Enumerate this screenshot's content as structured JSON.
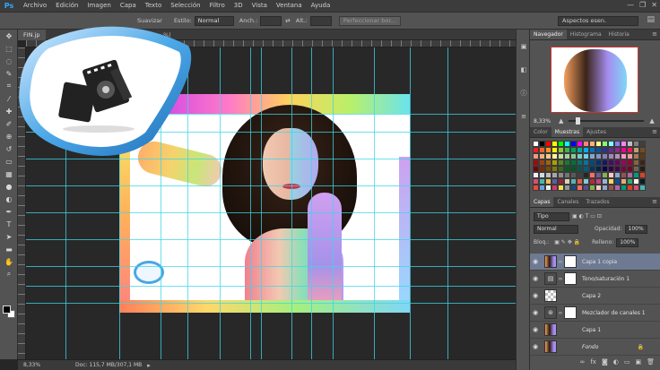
{
  "app": {
    "logo": "Ps"
  },
  "menu": [
    "Archivo",
    "Edición",
    "Imagen",
    "Capa",
    "Texto",
    "Selección",
    "Filtro",
    "3D",
    "Vista",
    "Ventana",
    "Ayuda"
  ],
  "window_controls": {
    "minimize": "—",
    "restore": "❐",
    "close": "✕"
  },
  "options": {
    "suavizar": "Suavizar",
    "estilo_label": "Estilo:",
    "estilo_value": "Normal",
    "anch_label": "Anch.:",
    "alt_label": "Alt.:",
    "perfeccionar": "Perfeccionar bor...",
    "workspace": "Aspectos esen."
  },
  "document": {
    "tab": "FIN.jp",
    "tab2": "%)",
    "status_zoom": "8,33%",
    "status_doc": "Doc: 115,7 MB/307,1 MB"
  },
  "navigator": {
    "tabs": [
      "Navegador",
      "Histograma",
      "Historia"
    ],
    "zoom": "8,33%"
  },
  "swatches_panel": {
    "tabs": [
      "Color",
      "Muestras",
      "Ajustes"
    ],
    "colors": [
      "#ffffff",
      "#000000",
      "#ff0000",
      "#ffff00",
      "#00ff00",
      "#00ffff",
      "#0000ff",
      "#ff00ff",
      "#ff8080",
      "#ffb080",
      "#ffff80",
      "#80ff80",
      "#80ffff",
      "#8080ff",
      "#ff80ff",
      "#c0c0c0",
      "#808080",
      "#404040",
      "#ee1d24",
      "#f26522",
      "#f7941d",
      "#fff200",
      "#8dc63f",
      "#39b54a",
      "#00a651",
      "#00a99d",
      "#00aeef",
      "#0072bc",
      "#0054a6",
      "#2e3192",
      "#662d91",
      "#92278f",
      "#ec008c",
      "#ed145b",
      "#c69c6d",
      "#754c24",
      "#f7977a",
      "#f9ad81",
      "#fdc68a",
      "#fff79a",
      "#c4df9b",
      "#a3d39c",
      "#82ca9c",
      "#7accc8",
      "#6dcff6",
      "#7da7d9",
      "#8393ca",
      "#8781bd",
      "#a186be",
      "#bd8cbf",
      "#f49ac2",
      "#f6989d",
      "#a67c52",
      "#603913",
      "#9e0b0f",
      "#a0410d",
      "#a3620a",
      "#aba000",
      "#598527",
      "#197b30",
      "#007236",
      "#00746b",
      "#0076a3",
      "#004a80",
      "#003471",
      "#1b1464",
      "#440e62",
      "#630460",
      "#9e005d",
      "#9e0039",
      "#8c6239",
      "#3c2415",
      "#790000",
      "#7b2e00",
      "#7d4900",
      "#827b00",
      "#406618",
      "#005e20",
      "#005826",
      "#005952",
      "#005b7f",
      "#003663",
      "#002157",
      "#0d004c",
      "#32004b",
      "#4b0049",
      "#7b0046",
      "#7a0026",
      "#736357",
      "#2a1a10",
      "#f2f2f2",
      "#d9d9d9",
      "#bfbfbf",
      "#a6a6a6",
      "#8c8c8c",
      "#737373",
      "#595959",
      "#404040",
      "#262626",
      "#ff6f61",
      "#6b5b95",
      "#88b04b",
      "#f7cac9",
      "#92a8d1",
      "#955251",
      "#b565a7",
      "#009b77",
      "#dd4124",
      "#d65076",
      "#45b8ac",
      "#efc050",
      "#5b5ea6",
      "#9b2335",
      "#dfcfbe",
      "#55b4b0",
      "#e15d44",
      "#7fcdcd",
      "#bc243c",
      "#c3447a",
      "#98b4d4",
      "#ffd662",
      "#00539c",
      "#eea47f",
      "#2bae66",
      "#fcf6f5",
      "#101820",
      "#e94b3c",
      "#6f9fd8",
      "#f0eee9",
      "#d2386c",
      "#f5df4d",
      "#939597",
      "#0f4c81",
      "#ff6f61",
      "#5f4b8b",
      "#88b04b",
      "#f7cac9",
      "#92a8d1",
      "#955251",
      "#b565a7",
      "#009b77",
      "#dd4124",
      "#d65076",
      "#45b8ac"
    ]
  },
  "layers_panel": {
    "tabs": [
      "Capas",
      "Canales",
      "Trazados"
    ],
    "kind": "Tipo",
    "blend": "Normal",
    "opacity_label": "Opacidad:",
    "opacity": "100%",
    "lock_label": "Bloq.:",
    "fill_label": "Relleno:",
    "fill": "100%",
    "layers": [
      {
        "name": "Capa 1 copia",
        "thumb": "photo",
        "mask": true,
        "selected": true,
        "italic": false,
        "locked": false
      },
      {
        "name": "Tono/saturación 1",
        "thumb": "adj",
        "mask": true,
        "selected": false,
        "italic": false,
        "locked": false
      },
      {
        "name": "Capa 2",
        "thumb": "checker",
        "mask": false,
        "selected": false,
        "italic": false,
        "locked": false
      },
      {
        "name": "Mezclador de canales 1",
        "thumb": "adj",
        "mask": true,
        "selected": false,
        "italic": false,
        "locked": false
      },
      {
        "name": "Capa 1",
        "thumb": "photo",
        "mask": false,
        "selected": false,
        "italic": false,
        "locked": false
      },
      {
        "name": "Fondo",
        "thumb": "photo",
        "mask": false,
        "selected": false,
        "italic": true,
        "locked": true
      }
    ],
    "footer_icons": [
      "link-icon",
      "fx-icon",
      "mask-icon",
      "adjustment-icon",
      "folder-icon",
      "new-layer-icon",
      "trash-icon"
    ]
  },
  "tools": [
    "move-tool",
    "marquee-tool",
    "lasso-tool",
    "quick-select-tool",
    "crop-tool",
    "eyedropper-tool",
    "healing-tool",
    "brush-tool",
    "clone-tool",
    "history-brush-tool",
    "eraser-tool",
    "gradient-tool",
    "blur-tool",
    "dodge-tool",
    "pen-tool",
    "type-tool",
    "path-select-tool",
    "shape-tool",
    "hand-tool",
    "zoom-tool"
  ]
}
